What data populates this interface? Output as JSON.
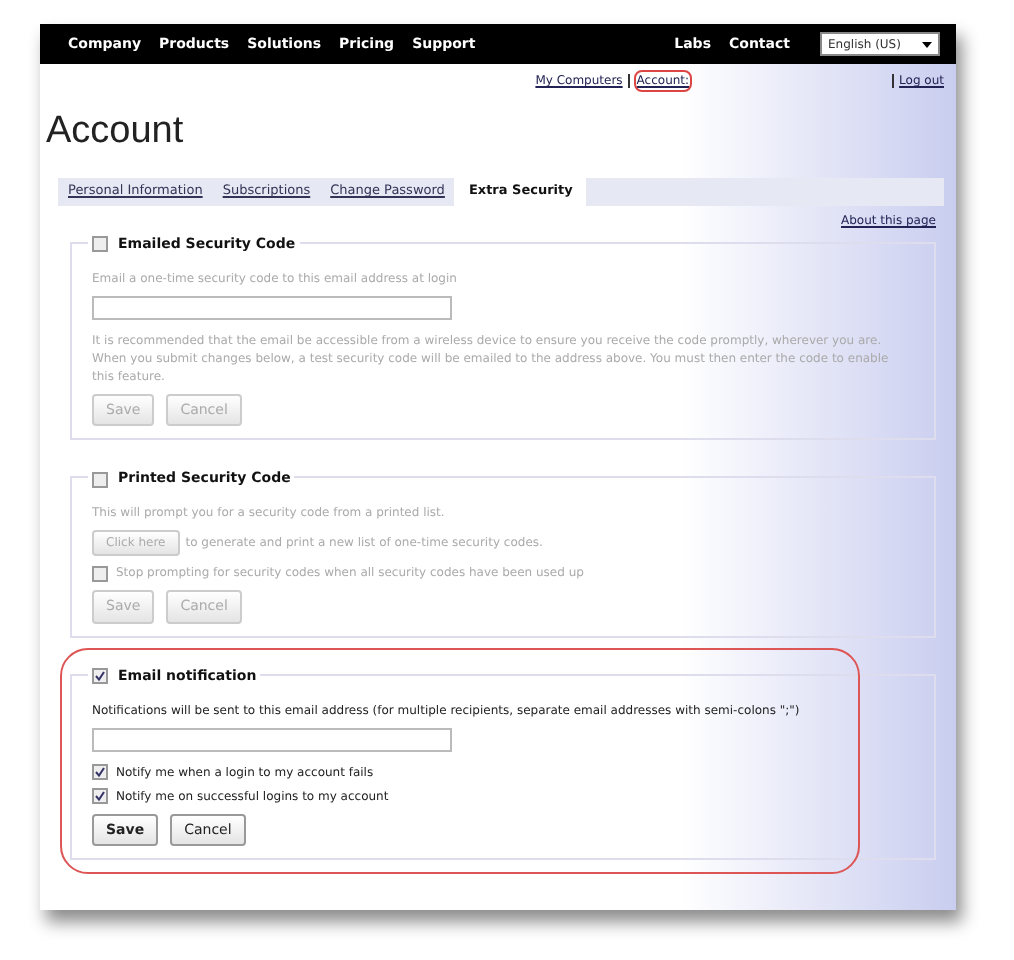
{
  "nav": {
    "items": [
      "Company",
      "Products",
      "Solutions",
      "Pricing",
      "Support"
    ],
    "right_items": [
      "Labs",
      "Contact"
    ],
    "language": "English (US)"
  },
  "user_links": [
    {
      "label": "My Computers",
      "highlighted": false
    },
    {
      "label": "Account:",
      "highlighted": true
    },
    {
      "label": "Log out",
      "highlighted": false
    }
  ],
  "title": "Account",
  "tabs": [
    {
      "label": "Personal Information",
      "selected": false
    },
    {
      "label": "Subscriptions",
      "selected": false
    },
    {
      "label": "Change Password",
      "selected": false
    },
    {
      "label": "Extra Security",
      "selected": true
    }
  ],
  "about_link": "About this page",
  "sections": [
    {
      "title": "Emailed Security Code",
      "checked": false,
      "highlighted": false,
      "items": [
        {
          "kind": "label",
          "text": "Email a one-time security code to this email address at login"
        },
        {
          "kind": "field"
        },
        {
          "kind": "note",
          "text": "It is recommended that the email be accessible from a wireless device to ensure you receive the code promptly, wherever you are. When you submit changes below, a test security code will be emailed to the address above. You must then enter the code to enable this feature."
        },
        {
          "kind": "buttons",
          "buttons": [
            "Save",
            "Cancel"
          ]
        }
      ]
    },
    {
      "title": "Printed Security Code",
      "checked": false,
      "highlighted": false,
      "items": [
        {
          "kind": "note",
          "text": "This will prompt you for a security code from a printed list."
        },
        {
          "kind": "action",
          "button": "Click here",
          "text": "to generate and print a new list of one-time security codes."
        },
        {
          "kind": "checkbox",
          "text": "Stop prompting for security codes when all security codes have been used up",
          "checked": false
        },
        {
          "kind": "buttons",
          "buttons": [
            "Save",
            "Cancel"
          ]
        }
      ]
    },
    {
      "title": "Email notification",
      "checked": true,
      "highlighted": true,
      "items": [
        {
          "kind": "label",
          "text": "Notifications will be sent to this email address (for multiple recipients, separate email addresses with semi-colons \";\")"
        },
        {
          "kind": "field"
        },
        {
          "kind": "checkbox",
          "text": "Notify me when a login to my account fails",
          "checked": true
        },
        {
          "kind": "checkbox",
          "text": "Notify me on successful logins to my account",
          "checked": true
        },
        {
          "kind": "buttons",
          "buttons": [
            "Save",
            "Cancel"
          ]
        }
      ]
    }
  ]
}
